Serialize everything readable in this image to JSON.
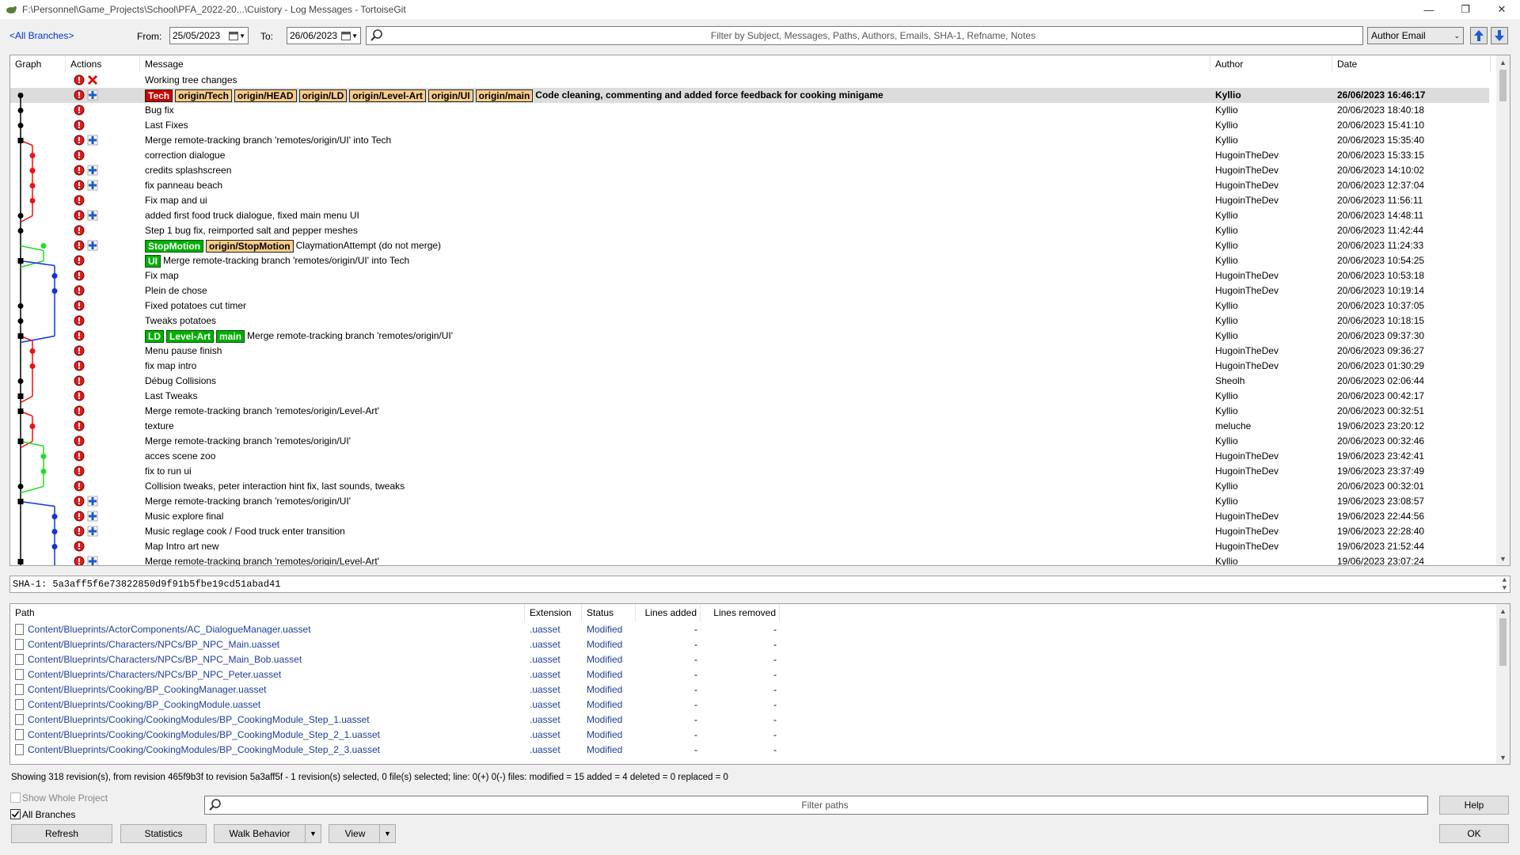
{
  "window": {
    "title": "F:\\Personnel\\Game_Projects\\School\\PFA_2022-20...\\Cuistory - Log Messages - TortoiseGit"
  },
  "toolbar": {
    "branch_link": "<All Branches>",
    "from_label": "From:",
    "from_date": "25/05/2023",
    "to_label": "To:",
    "to_date": "26/06/2023",
    "filter_placeholder": "Filter by Subject, Messages, Paths, Authors, Emails, SHA-1, Refname, Notes",
    "filter_field": "Author Email"
  },
  "log": {
    "columns": [
      "Graph",
      "Actions",
      "Message",
      "Author",
      "Date"
    ],
    "rows": [
      {
        "refs": [],
        "message": "Working tree changes",
        "author": "",
        "date": "",
        "actions": [
          "red",
          "cross"
        ],
        "dot": ""
      },
      {
        "refs": [
          {
            "label": "Tech",
            "style": "tech"
          },
          {
            "label": "origin/Tech",
            "style": "orange"
          },
          {
            "label": "origin/HEAD",
            "style": "orange"
          },
          {
            "label": "origin/LD",
            "style": "orange"
          },
          {
            "label": "origin/Level-Art",
            "style": "orange"
          },
          {
            "label": "origin/UI",
            "style": "orange"
          },
          {
            "label": "origin/main",
            "style": "orange"
          }
        ],
        "message": "Code cleaning, commenting and added force feedback for cooking minigame",
        "author": "Kyllio",
        "date": "26/06/2023 16:46:17",
        "actions": [
          "red",
          "plus"
        ],
        "dot": "black",
        "selected": true
      },
      {
        "refs": [],
        "message": "Bug fix",
        "author": "Kyllio",
        "date": "20/06/2023 18:40:18",
        "actions": [
          "red"
        ],
        "dot": "black"
      },
      {
        "refs": [],
        "message": "Last Fixes",
        "author": "Kyllio",
        "date": "20/06/2023 15:41:10",
        "actions": [
          "red"
        ],
        "dot": "black"
      },
      {
        "refs": [],
        "message": "Merge remote-tracking branch 'remotes/origin/UI' into Tech",
        "author": "Kyllio",
        "date": "20/06/2023 15:35:40",
        "actions": [
          "red",
          "plus"
        ],
        "dot": "black-sq"
      },
      {
        "refs": [],
        "message": "correction dialogue",
        "author": "HugoinTheDev",
        "date": "20/06/2023 15:33:15",
        "actions": [
          "red"
        ],
        "dot": "red"
      },
      {
        "refs": [],
        "message": "credits splashscreen",
        "author": "HugoinTheDev",
        "date": "20/06/2023 14:10:02",
        "actions": [
          "red",
          "plus"
        ],
        "dot": "red"
      },
      {
        "refs": [],
        "message": "fix panneau beach",
        "author": "HugoinTheDev",
        "date": "20/06/2023 12:37:04",
        "actions": [
          "red",
          "plus"
        ],
        "dot": "red"
      },
      {
        "refs": [],
        "message": "Fix map and ui",
        "author": "HugoinTheDev",
        "date": "20/06/2023 11:56:11",
        "actions": [
          "red"
        ],
        "dot": "red"
      },
      {
        "refs": [],
        "message": "added first food truck dialogue, fixed main menu UI",
        "author": "Kyllio",
        "date": "20/06/2023 14:48:11",
        "actions": [
          "red",
          "plus"
        ],
        "dot": "black"
      },
      {
        "refs": [],
        "message": "Step 1 bug fix, reimported salt and pepper meshes",
        "author": "Kyllio",
        "date": "20/06/2023 11:42:44",
        "actions": [
          "red"
        ],
        "dot": "black"
      },
      {
        "refs": [
          {
            "label": "StopMotion",
            "style": "green"
          },
          {
            "label": "origin/StopMotion",
            "style": "orange"
          }
        ],
        "message": "ClaymationAttempt (do not merge)",
        "author": "Kyllio",
        "date": "20/06/2023 11:24:33",
        "actions": [
          "red",
          "plus"
        ],
        "dot": "green"
      },
      {
        "refs": [
          {
            "label": "UI",
            "style": "green"
          }
        ],
        "message": "Merge remote-tracking branch 'remotes/origin/UI' into Tech",
        "author": "Kyllio",
        "date": "20/06/2023 10:54:25",
        "actions": [
          "red"
        ],
        "dot": "black-sq"
      },
      {
        "refs": [],
        "message": "Fix map",
        "author": "HugoinTheDev",
        "date": "20/06/2023 10:53:18",
        "actions": [
          "red"
        ],
        "dot": "blue"
      },
      {
        "refs": [],
        "message": "Plein de chose",
        "author": "HugoinTheDev",
        "date": "20/06/2023 10:19:14",
        "actions": [
          "red"
        ],
        "dot": "blue"
      },
      {
        "refs": [],
        "message": "Fixed potatoes cut timer",
        "author": "Kyllio",
        "date": "20/06/2023 10:37:05",
        "actions": [
          "red"
        ],
        "dot": "black"
      },
      {
        "refs": [],
        "message": "Tweaks potatoes",
        "author": "Kyllio",
        "date": "20/06/2023 10:18:15",
        "actions": [
          "red"
        ],
        "dot": "black"
      },
      {
        "refs": [
          {
            "label": "LD",
            "style": "green"
          },
          {
            "label": "Level-Art",
            "style": "green"
          },
          {
            "label": "main",
            "style": "green"
          }
        ],
        "message": "Merge remote-tracking branch 'remotes/origin/UI'",
        "author": "Kyllio",
        "date": "20/06/2023 09:37:30",
        "actions": [
          "red"
        ],
        "dot": "black-sq"
      },
      {
        "refs": [],
        "message": "Menu pause finish",
        "author": "HugoinTheDev",
        "date": "20/06/2023 09:36:27",
        "actions": [
          "red"
        ],
        "dot": "red"
      },
      {
        "refs": [],
        "message": "fix map intro",
        "author": "HugoinTheDev",
        "date": "20/06/2023 01:30:29",
        "actions": [
          "red"
        ],
        "dot": "red"
      },
      {
        "refs": [],
        "message": "Débug Collisions",
        "author": "Sheolh",
        "date": "20/06/2023 02:06:44",
        "actions": [
          "red"
        ],
        "dot": "black"
      },
      {
        "refs": [],
        "message": "Last Tweaks",
        "author": "Kyllio",
        "date": "20/06/2023 00:42:17",
        "actions": [
          "red"
        ],
        "dot": "black-sq"
      },
      {
        "refs": [],
        "message": "Merge remote-tracking branch 'remotes/origin/Level-Art'",
        "author": "Kyllio",
        "date": "20/06/2023 00:32:51",
        "actions": [
          "red"
        ],
        "dot": "black-sq"
      },
      {
        "refs": [],
        "message": "texture",
        "author": "meluche",
        "date": "19/06/2023 23:20:12",
        "actions": [
          "red"
        ],
        "dot": "red"
      },
      {
        "refs": [],
        "message": "Merge remote-tracking branch 'remotes/origin/UI'",
        "author": "Kyllio",
        "date": "20/06/2023 00:32:46",
        "actions": [
          "red"
        ],
        "dot": "black-sq"
      },
      {
        "refs": [],
        "message": "acces scene zoo",
        "author": "HugoinTheDev",
        "date": "19/06/2023 23:42:41",
        "actions": [
          "red"
        ],
        "dot": "green"
      },
      {
        "refs": [],
        "message": "fix to run ui",
        "author": "HugoinTheDev",
        "date": "19/06/2023 23:37:49",
        "actions": [
          "red"
        ],
        "dot": "green"
      },
      {
        "refs": [],
        "message": "Collision tweaks, peter interaction hint fix, last sounds, tweaks",
        "author": "Kyllio",
        "date": "20/06/2023 00:32:01",
        "actions": [
          "red"
        ],
        "dot": "black"
      },
      {
        "refs": [],
        "message": "Merge remote-tracking branch 'remotes/origin/UI'",
        "author": "Kyllio",
        "date": "19/06/2023 23:08:57",
        "actions": [
          "red",
          "plus"
        ],
        "dot": "black-sq"
      },
      {
        "refs": [],
        "message": "Music explore final",
        "author": "HugoinTheDev",
        "date": "19/06/2023 22:44:56",
        "actions": [
          "red",
          "plus"
        ],
        "dot": "blue"
      },
      {
        "refs": [],
        "message": "Music reglage cook / Food truck enter transition",
        "author": "HugoinTheDev",
        "date": "19/06/2023 22:28:40",
        "actions": [
          "red",
          "plus"
        ],
        "dot": "blue"
      },
      {
        "refs": [],
        "message": "Map Intro art new",
        "author": "HugoinTheDev",
        "date": "19/06/2023 21:52:44",
        "actions": [
          "red"
        ],
        "dot": "blue"
      },
      {
        "refs": [],
        "message": "Merge remote-tracking branch 'remotes/origin/Level-Art'",
        "author": "Kyllio",
        "date": "19/06/2023 23:07:24",
        "actions": [
          "red",
          "plus"
        ],
        "dot": "black-sq"
      }
    ]
  },
  "sha": "SHA-1: 5a3aff5f6e73822850d9f91b5fbe19cd51abad41",
  "files": {
    "columns": [
      "Path",
      "Extension",
      "Status",
      "Lines added",
      "Lines removed"
    ],
    "rows": [
      {
        "path": "Content/Blueprints/ActorComponents/AC_DialogueManager.uasset",
        "ext": ".uasset",
        "status": "Modified",
        "added": "-",
        "removed": "-"
      },
      {
        "path": "Content/Blueprints/Characters/NPCs/BP_NPC_Main.uasset",
        "ext": ".uasset",
        "status": "Modified",
        "added": "-",
        "removed": "-"
      },
      {
        "path": "Content/Blueprints/Characters/NPCs/BP_NPC_Main_Bob.uasset",
        "ext": ".uasset",
        "status": "Modified",
        "added": "-",
        "removed": "-"
      },
      {
        "path": "Content/Blueprints/Characters/NPCs/BP_NPC_Peter.uasset",
        "ext": ".uasset",
        "status": "Modified",
        "added": "-",
        "removed": "-"
      },
      {
        "path": "Content/Blueprints/Cooking/BP_CookingManager.uasset",
        "ext": ".uasset",
        "status": "Modified",
        "added": "-",
        "removed": "-"
      },
      {
        "path": "Content/Blueprints/Cooking/BP_CookingModule.uasset",
        "ext": ".uasset",
        "status": "Modified",
        "added": "-",
        "removed": "-"
      },
      {
        "path": "Content/Blueprints/Cooking/CookingModules/BP_CookingModule_Step_1.uasset",
        "ext": ".uasset",
        "status": "Modified",
        "added": "-",
        "removed": "-"
      },
      {
        "path": "Content/Blueprints/Cooking/CookingModules/BP_CookingModule_Step_2_1.uasset",
        "ext": ".uasset",
        "status": "Modified",
        "added": "-",
        "removed": "-"
      },
      {
        "path": "Content/Blueprints/Cooking/CookingModules/BP_CookingModule_Step_2_3.uasset",
        "ext": ".uasset",
        "status": "Modified",
        "added": "-",
        "removed": "-"
      }
    ]
  },
  "status_text": "Showing 318 revision(s), from revision 465f9b3f to revision 5a3aff5f - 1 revision(s) selected, 0 file(s) selected; line: 0(+) 0(-) files: modified = 15 added = 4 deleted = 0 replaced = 0",
  "bottom": {
    "show_whole_project": "Show Whole Project",
    "all_branches": "All Branches",
    "filter_paths": "Filter paths",
    "help": "Help",
    "refresh": "Refresh",
    "statistics": "Statistics",
    "walk_behavior": "Walk Behavior",
    "view": "View",
    "ok": "OK"
  },
  "colors": {
    "tech_ref": "#cc0000",
    "remote_ref": "#f7cc88",
    "local_ref": "#00b000",
    "graph_red": "#ee1111",
    "graph_blue": "#1133dd",
    "graph_green": "#22dd22",
    "link": "#1f3e9a"
  }
}
